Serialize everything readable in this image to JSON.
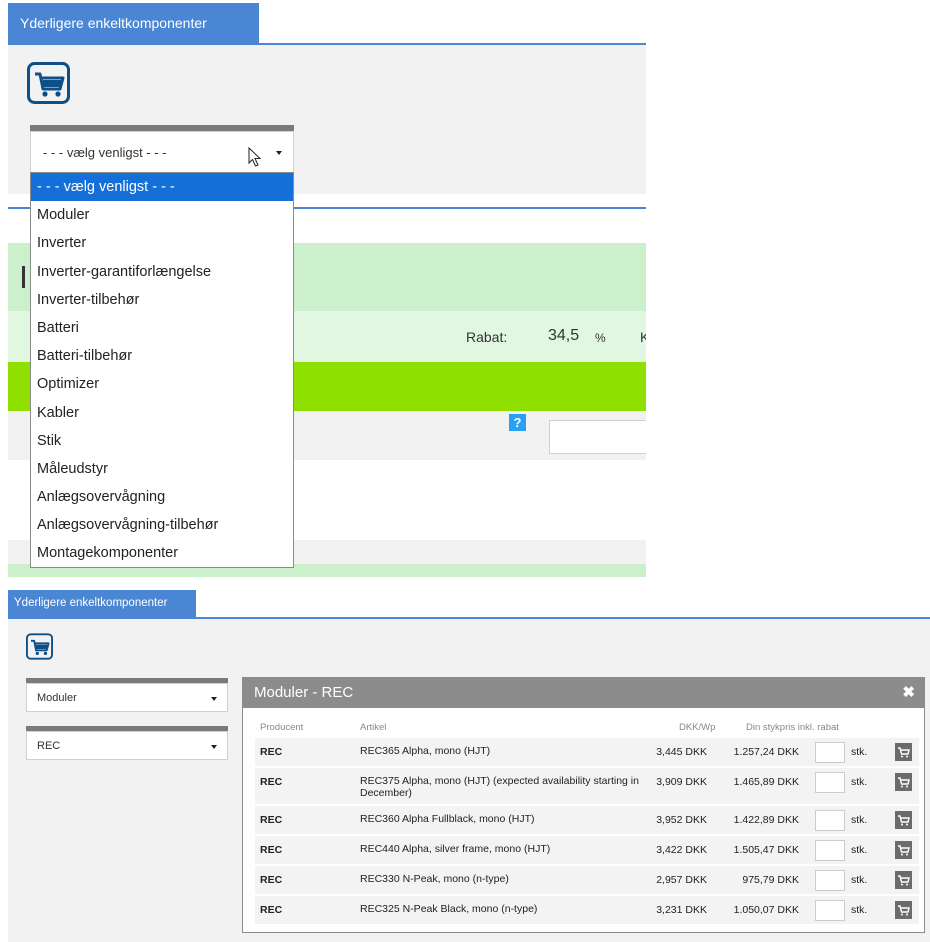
{
  "top": {
    "tab_label": "Yderligere enkeltkomponenter",
    "select_value": "- - - vælg venligst - - -",
    "dropdown_options": [
      "- - - vælg venligst - - -",
      "Moduler",
      "Inverter",
      "Inverter-garantiforlængelse",
      "Inverter-tilbehør",
      "Batteri",
      "Batteri-tilbehør",
      "Optimizer",
      "Kabler",
      "Stik",
      "Måleudstyr",
      "Anlægsovervågning",
      "Anlægsovervågning-tilbehør",
      "Montagekomponenter"
    ],
    "rabat_label": "Rabat:",
    "rabat_value": "34,5",
    "rabat_unit": "%",
    "rabat_next_label_fragment": "K",
    "help_glyph": "?"
  },
  "bottom": {
    "tab_label": "Yderligere enkeltkomponenter",
    "select_category": "Moduler",
    "select_brand": "REC",
    "modal": {
      "title": "Moduler - REC",
      "close_glyph": "✖",
      "headers": {
        "producent": "Producent",
        "artikel": "Artikel",
        "dkk_wp": "DKK/Wp",
        "pris": "Din stykpris inkl. rabat"
      },
      "unit_label": "stk.",
      "rows": [
        {
          "producent": "REC",
          "artikel": "REC365 Alpha, mono (HJT)",
          "dkk_wp": "3,445 DKK",
          "pris": "1.257,24 DKK"
        },
        {
          "producent": "REC",
          "artikel": "REC375 Alpha, mono (HJT) (expected availability starting in December)",
          "dkk_wp": "3,909 DKK",
          "pris": "1.465,89 DKK"
        },
        {
          "producent": "REC",
          "artikel": "REC360 Alpha Fullblack, mono (HJT)",
          "dkk_wp": "3,952 DKK",
          "pris": "1.422,89 DKK"
        },
        {
          "producent": "REC",
          "artikel": "REC440 Alpha, silver frame, mono (HJT)",
          "dkk_wp": "3,422 DKK",
          "pris": "1.505,47 DKK"
        },
        {
          "producent": "REC",
          "artikel": "REC330 N-Peak, mono (n-type)",
          "dkk_wp": "2,957 DKK",
          "pris": "975,79 DKK"
        },
        {
          "producent": "REC",
          "artikel": "REC325 N-Peak Black, mono (n-type)",
          "dkk_wp": "3,231 DKK",
          "pris": "1.050,07 DKK"
        }
      ]
    }
  },
  "colors": {
    "accent_blue": "#4a86d4",
    "selected_blue": "#1470d8",
    "lime": "#8fe000",
    "light_green": "#ccefcc",
    "help_blue": "#2aa0f5"
  },
  "icons": {
    "cart": "shopping-cart-icon",
    "cursor": "mouse-pointer-icon",
    "help": "help-icon",
    "close": "close-icon",
    "caret": "caret-down-icon"
  }
}
